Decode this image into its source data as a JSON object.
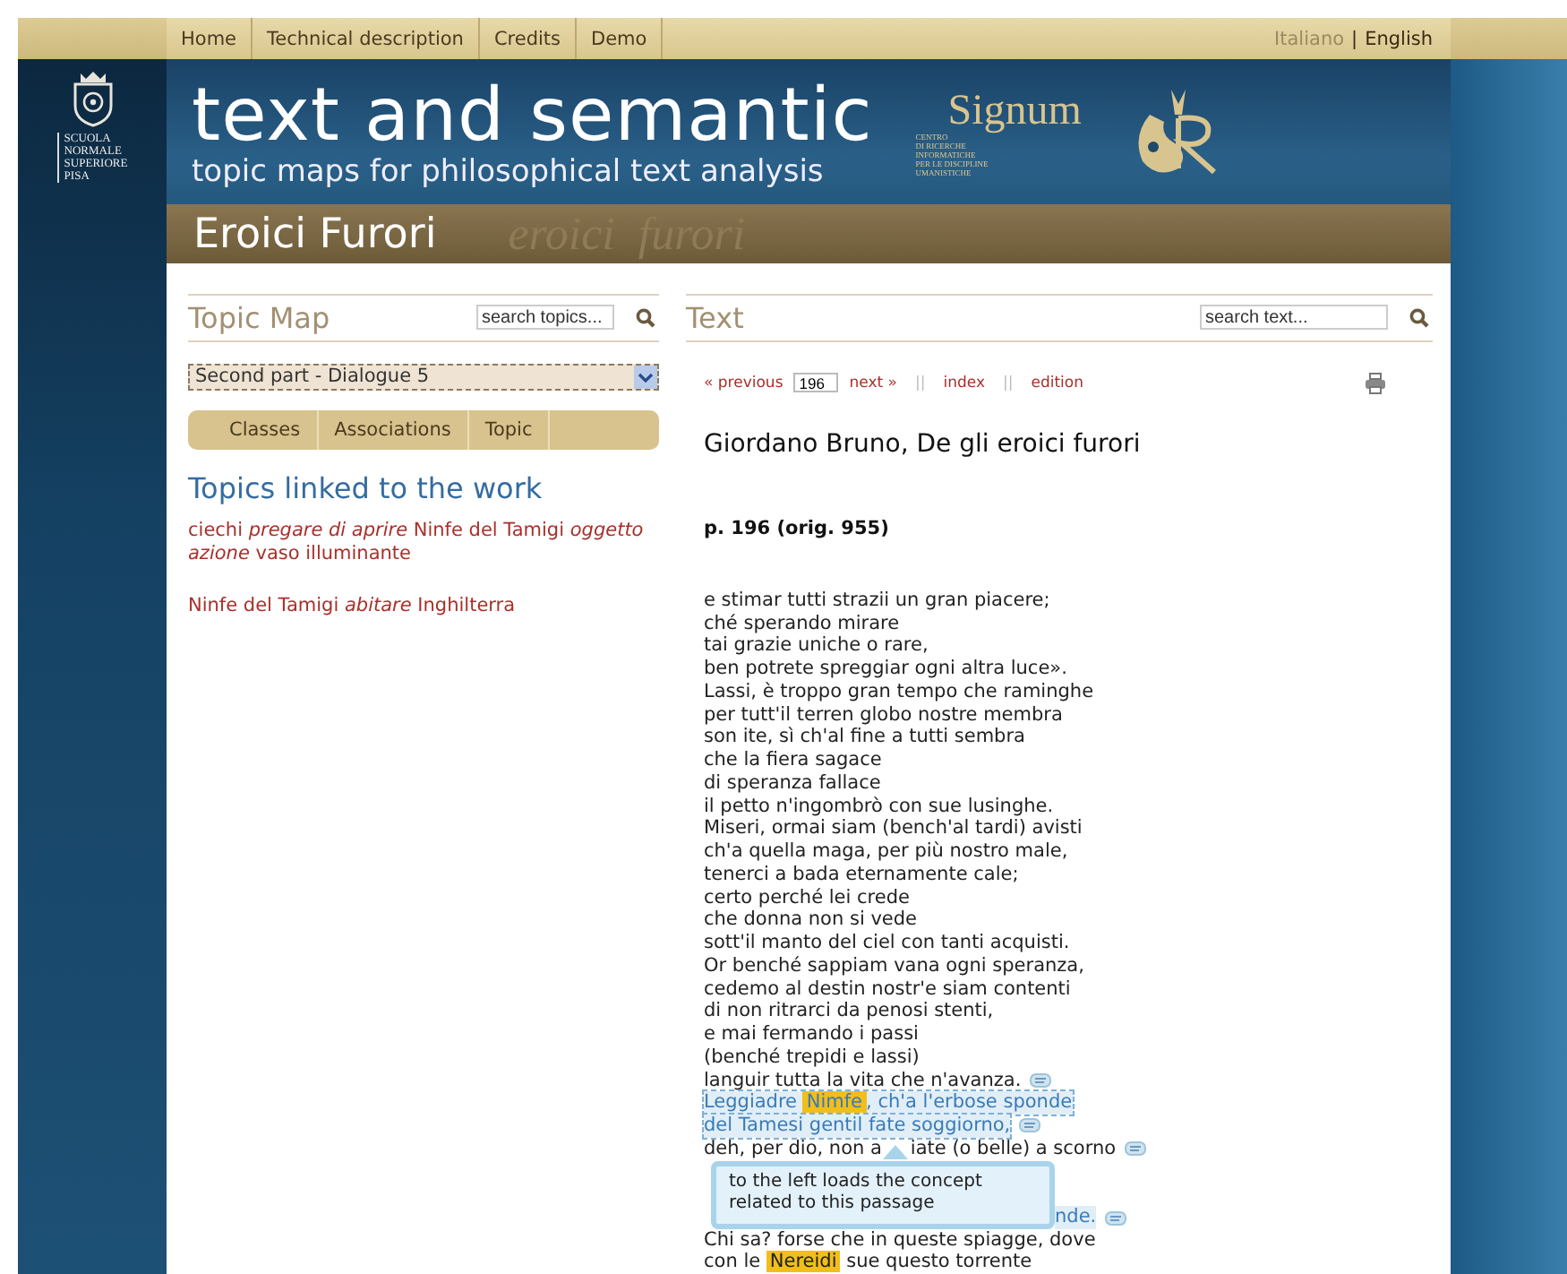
{
  "nav": {
    "items": [
      {
        "label": "Home"
      },
      {
        "label": "Technical description"
      },
      {
        "label": "Credits"
      },
      {
        "label": "Demo"
      }
    ],
    "languages": [
      {
        "label": "Italiano",
        "selected": false
      },
      {
        "label": "English",
        "selected": true
      }
    ],
    "language_separator": "|"
  },
  "sidebar_logo": {
    "lines": [
      "SCUOLA",
      "NORMALE",
      "SUPERIORE",
      "PISA"
    ]
  },
  "header": {
    "title": "text and semantic",
    "subtitle": "topic maps for philosophical text analysis",
    "signum": {
      "name": "Signum",
      "lines": [
        "CENTRO",
        "DI RICERCHE",
        "INFORMATICHE",
        "PER LE DISCIPLINE",
        "UMANISTICHE"
      ]
    }
  },
  "band": {
    "title": "Eroici Furori",
    "decoration": "eroici  furori"
  },
  "topic_map": {
    "title": "Topic Map",
    "search": {
      "placeholder": "search topics..."
    },
    "select": {
      "value": "Second part - Dialogue 5"
    },
    "tabs": [
      {
        "label": "Classes"
      },
      {
        "label": "Associations"
      },
      {
        "label": "Topic"
      }
    ],
    "heading": "Topics linked to the work",
    "links": [
      "ciechi *pregare di aprire* Ninfe del Tamigi *oggetto azione* vaso illuminante",
      "Ninfe del Tamigi *abitare* Inghilterra"
    ]
  },
  "text_panel": {
    "title": "Text",
    "search": {
      "placeholder": "search text..."
    },
    "pager": {
      "previous": "« previous",
      "page": "196",
      "next": "next »",
      "separator": "||",
      "index": "index",
      "edition": "edition"
    },
    "work_title": "Giordano Bruno, De gli eroici furori",
    "page_label": "p. 196 (orig. 955)",
    "lines": [
      {
        "text": "e stimar tutti strazii un gran piacere;"
      },
      {
        "text": "ché sperando mirare"
      },
      {
        "text": "tai grazie uniche o rare,"
      },
      {
        "text": "ben potrete spreggiar ogni altra luce»."
      },
      {
        "text": "Lassi, è troppo gran tempo che raminghe"
      },
      {
        "text": "per tutt'il terren globo nostre membra"
      },
      {
        "text": "son ite, sì ch'al fine a tutti sembra"
      },
      {
        "text": "che la fiera sagace"
      },
      {
        "text": "di speranza fallace"
      },
      {
        "text": "il petto n'ingombrò con sue lusinghe."
      },
      {
        "text": "Miseri, ormai siam (bench'al tardi) avisti"
      },
      {
        "text": "ch'a quella maga, per più nostro male,"
      },
      {
        "text": "tenerci a bada eternamente cale;"
      },
      {
        "text": "certo perché lei crede"
      },
      {
        "text": "che donna non si vede"
      },
      {
        "text": "sott'il manto del ciel con tanti acquisti."
      },
      {
        "text": "Or benché sappiam vana ogni speranza,"
      },
      {
        "text": "cedemo al destin nostr'e siam contenti"
      },
      {
        "text": "di non ritrarci da penosi stenti,"
      },
      {
        "text": "e mai fermando i passi"
      },
      {
        "text": "(benché trepidi e lassi)"
      },
      {
        "text": "languir tutta la vita che n'avanza.",
        "concept_icon": true
      },
      {
        "segments": [
          {
            "text": "Leggiadre "
          },
          {
            "text": "Nimfe",
            "highlight": true
          },
          {
            "text": ", ch'a l'erbose sponde"
          }
        ],
        "passage": true
      },
      {
        "text": "del Tamesi gentil fate soggiorno,",
        "passage": true,
        "concept_icon": true
      },
      {
        "segments": [
          {
            "text": "deh, per dio, non a"
          },
          {
            "text": "iate (o belle) a scorno",
            "after_gap": true
          }
        ],
        "concept_icon": true
      },
      {
        "tail": "nde.",
        "passage": true,
        "concept_icon": true
      },
      {
        "text": "Chi sa? forse che in queste spiagge, dove"
      },
      {
        "segments": [
          {
            "text": "con le "
          },
          {
            "text": "Nereidi",
            "highlight": true
          },
          {
            "text": " sue questo torrente"
          }
        ]
      }
    ],
    "tooltip": "to the left loads the concept\nrelated to this passage"
  }
}
